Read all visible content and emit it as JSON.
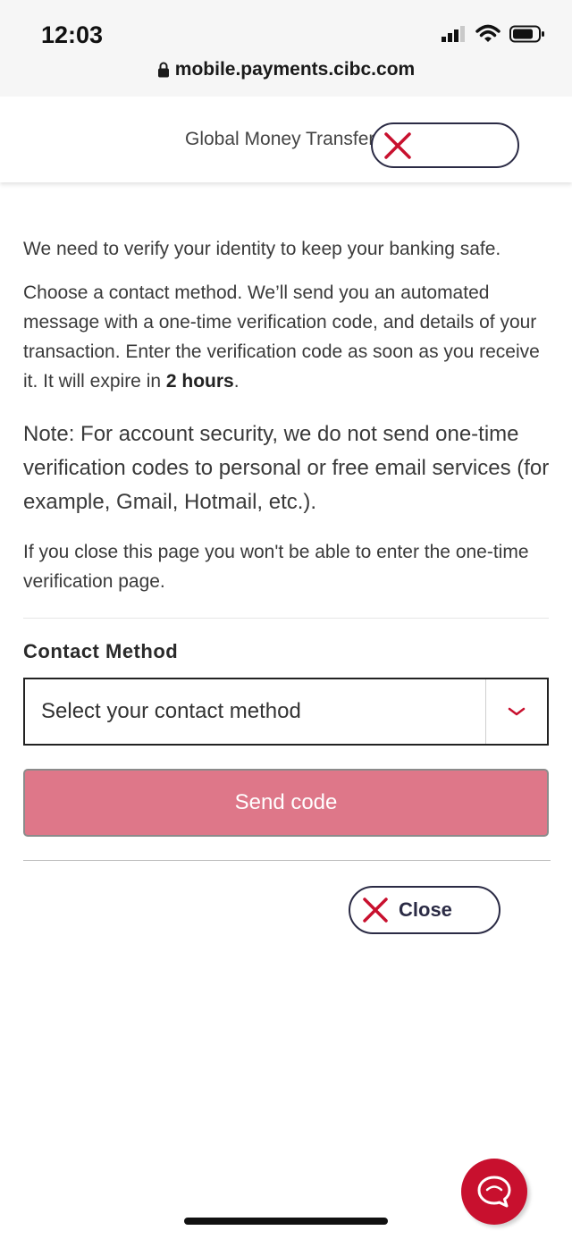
{
  "status_bar": {
    "time": "12:03",
    "url": "mobile.payments.cibc.com"
  },
  "header": {
    "title": "Global Money Transfer"
  },
  "content": {
    "intro": "We need to verify your identity to keep your banking safe.",
    "instructions_part1": "Choose a contact method. We’ll send you an automated message with a one-time verification code, and details of your transaction. Enter the verification code as soon as you receive it. It will expire in ",
    "instructions_bold": "2 hours",
    "instructions_part2": ".",
    "note": "Note: For account security, we do not send one-time verification codes to personal or free email services (for example, Gmail, Hotmail, etc.).",
    "close_warning": "If you close this page you won't be able to enter the one-time verification page."
  },
  "form": {
    "contact_label": "Contact Method",
    "select_placeholder": "Select your contact method",
    "send_button": "Send code"
  },
  "footer": {
    "close_button": "Close"
  },
  "colors": {
    "brand_red": "#c8102e",
    "send_button_disabled": "#de7789",
    "navy": "#2b2b45"
  },
  "icons": {
    "lock": "lock-icon",
    "close": "close-x-icon",
    "chevron": "chevron-down-icon",
    "chat": "chat-icon"
  }
}
